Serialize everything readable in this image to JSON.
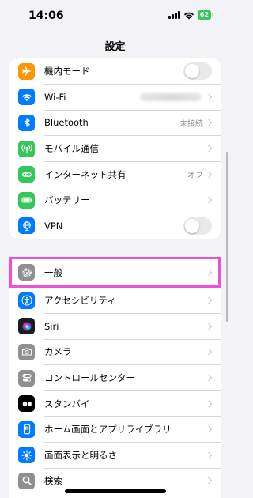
{
  "status_bar": {
    "time": "14:06",
    "battery": "62"
  },
  "header": {
    "title": "設定"
  },
  "groups": [
    {
      "items": [
        {
          "label": "機内モード",
          "icon": "airplane-icon",
          "color": "#ff9500",
          "control": "toggle",
          "on": false
        },
        {
          "label": "Wi-Fi",
          "icon": "wifi-icon",
          "color": "#007aff",
          "control": "chevron",
          "value_blurred": true
        },
        {
          "label": "Bluetooth",
          "icon": "bluetooth-icon",
          "color": "#007aff",
          "control": "chevron",
          "value": "未接続"
        },
        {
          "label": "モバイル通信",
          "icon": "antenna-icon",
          "color": "#34c759",
          "control": "chevron"
        },
        {
          "label": "インターネット共有",
          "icon": "link-icon",
          "color": "#34c759",
          "control": "chevron",
          "value": "オフ"
        },
        {
          "label": "バッテリー",
          "icon": "battery-icon",
          "color": "#34c759",
          "control": "chevron"
        },
        {
          "label": "VPN",
          "icon": "globe-icon",
          "color": "#007aff",
          "control": "toggle",
          "on": false
        }
      ]
    },
    {
      "items": [
        {
          "label": "一般",
          "icon": "gear-icon",
          "color": "#8e8e93",
          "control": "chevron",
          "highlighted": true
        },
        {
          "label": "アクセシビリティ",
          "icon": "accessibility-icon",
          "color": "#007aff",
          "control": "chevron"
        },
        {
          "label": "Siri",
          "icon": "siri-icon",
          "color": "#1c1c1e",
          "control": "chevron"
        },
        {
          "label": "カメラ",
          "icon": "camera-icon",
          "color": "#8e8e93",
          "control": "chevron"
        },
        {
          "label": "コントロールセンター",
          "icon": "switches-icon",
          "color": "#8e8e93",
          "control": "chevron"
        },
        {
          "label": "スタンバイ",
          "icon": "standby-icon",
          "color": "#000000",
          "control": "chevron"
        },
        {
          "label": "ホーム画面とアプリライブラリ",
          "icon": "phone-icon",
          "color": "#007aff",
          "control": "chevron"
        },
        {
          "label": "画面表示と明るさ",
          "icon": "sun-icon",
          "color": "#007aff",
          "control": "chevron"
        },
        {
          "label": "検索",
          "icon": "search-icon",
          "color": "#8e8e93",
          "control": "chevron"
        }
      ]
    }
  ],
  "colors": {
    "highlight": "#f04fd8",
    "background": "#f2f2f7"
  }
}
